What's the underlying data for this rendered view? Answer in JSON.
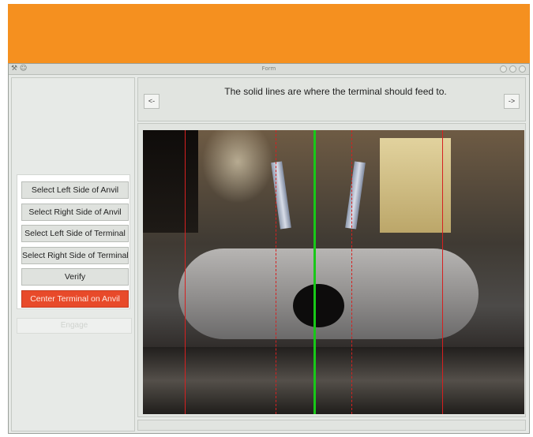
{
  "window": {
    "title": "Form",
    "left_glyphs": "⚒ ☺"
  },
  "sidebar": {
    "buttons": [
      {
        "label": "Select Left Side of Anvil"
      },
      {
        "label": "Select Right Side of Anvil"
      },
      {
        "label": "Select Left Side of Terminal"
      },
      {
        "label": "Select Right Side of Terminal"
      },
      {
        "label": "Verify"
      },
      {
        "label": "Center Terminal on Anvil"
      }
    ],
    "disabled_button": {
      "label": "Engage"
    }
  },
  "header": {
    "instruction": "The solid lines are where the terminal should feed to.",
    "prev_label": "<-",
    "next_label": "->"
  },
  "colors": {
    "banner": "#f5901f",
    "active_button": "#e84a2a",
    "guide_line_solid": "#d62020",
    "center_line": "#18c818"
  },
  "icons": [
    "close-icon",
    "minimize-icon",
    "maximize-icon"
  ]
}
